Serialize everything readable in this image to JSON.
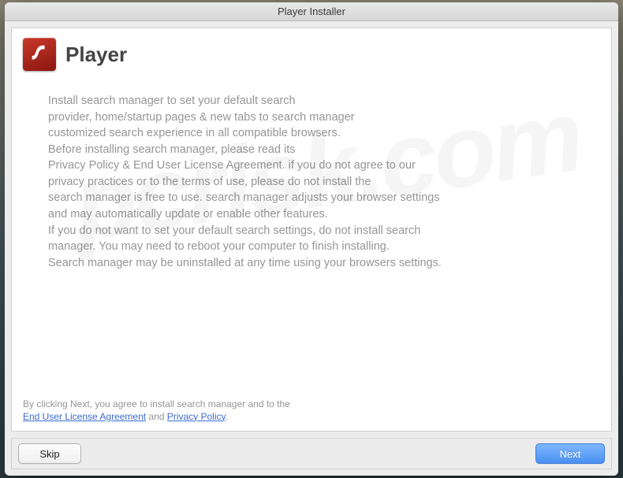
{
  "window": {
    "title": "Player Installer"
  },
  "header": {
    "app_name": "Player",
    "icon_name": "flash-icon"
  },
  "body": {
    "text": "Install search manager to set your default search\nprovider, home/startup pages & new tabs to search manager\ncustomized search experience in all compatible browsers.\nBefore installing search manager, please read its\nPrivacy Policy & End User License Agreement. if you do not agree to our\nprivacy practices or to the terms of use, please do not install the\nsearch manager is free to use. search manager adjusts your browser settings\nand may automatically update or enable other features.\nIf you do not want to set your default search settings, do not install search\nmanager. You may need to reboot your computer to finish installing.\nSearch manager may be uninstalled at any time using your browsers settings."
  },
  "footer": {
    "prefix": "By clicking Next, you agree to install search manager and to the",
    "eula_link": "End User License Agreement",
    "and": " and ",
    "privacy_link": "Privacy Policy",
    "suffix": "."
  },
  "buttons": {
    "skip": "Skip",
    "next": "Next"
  },
  "watermark": "pcrisk.com"
}
